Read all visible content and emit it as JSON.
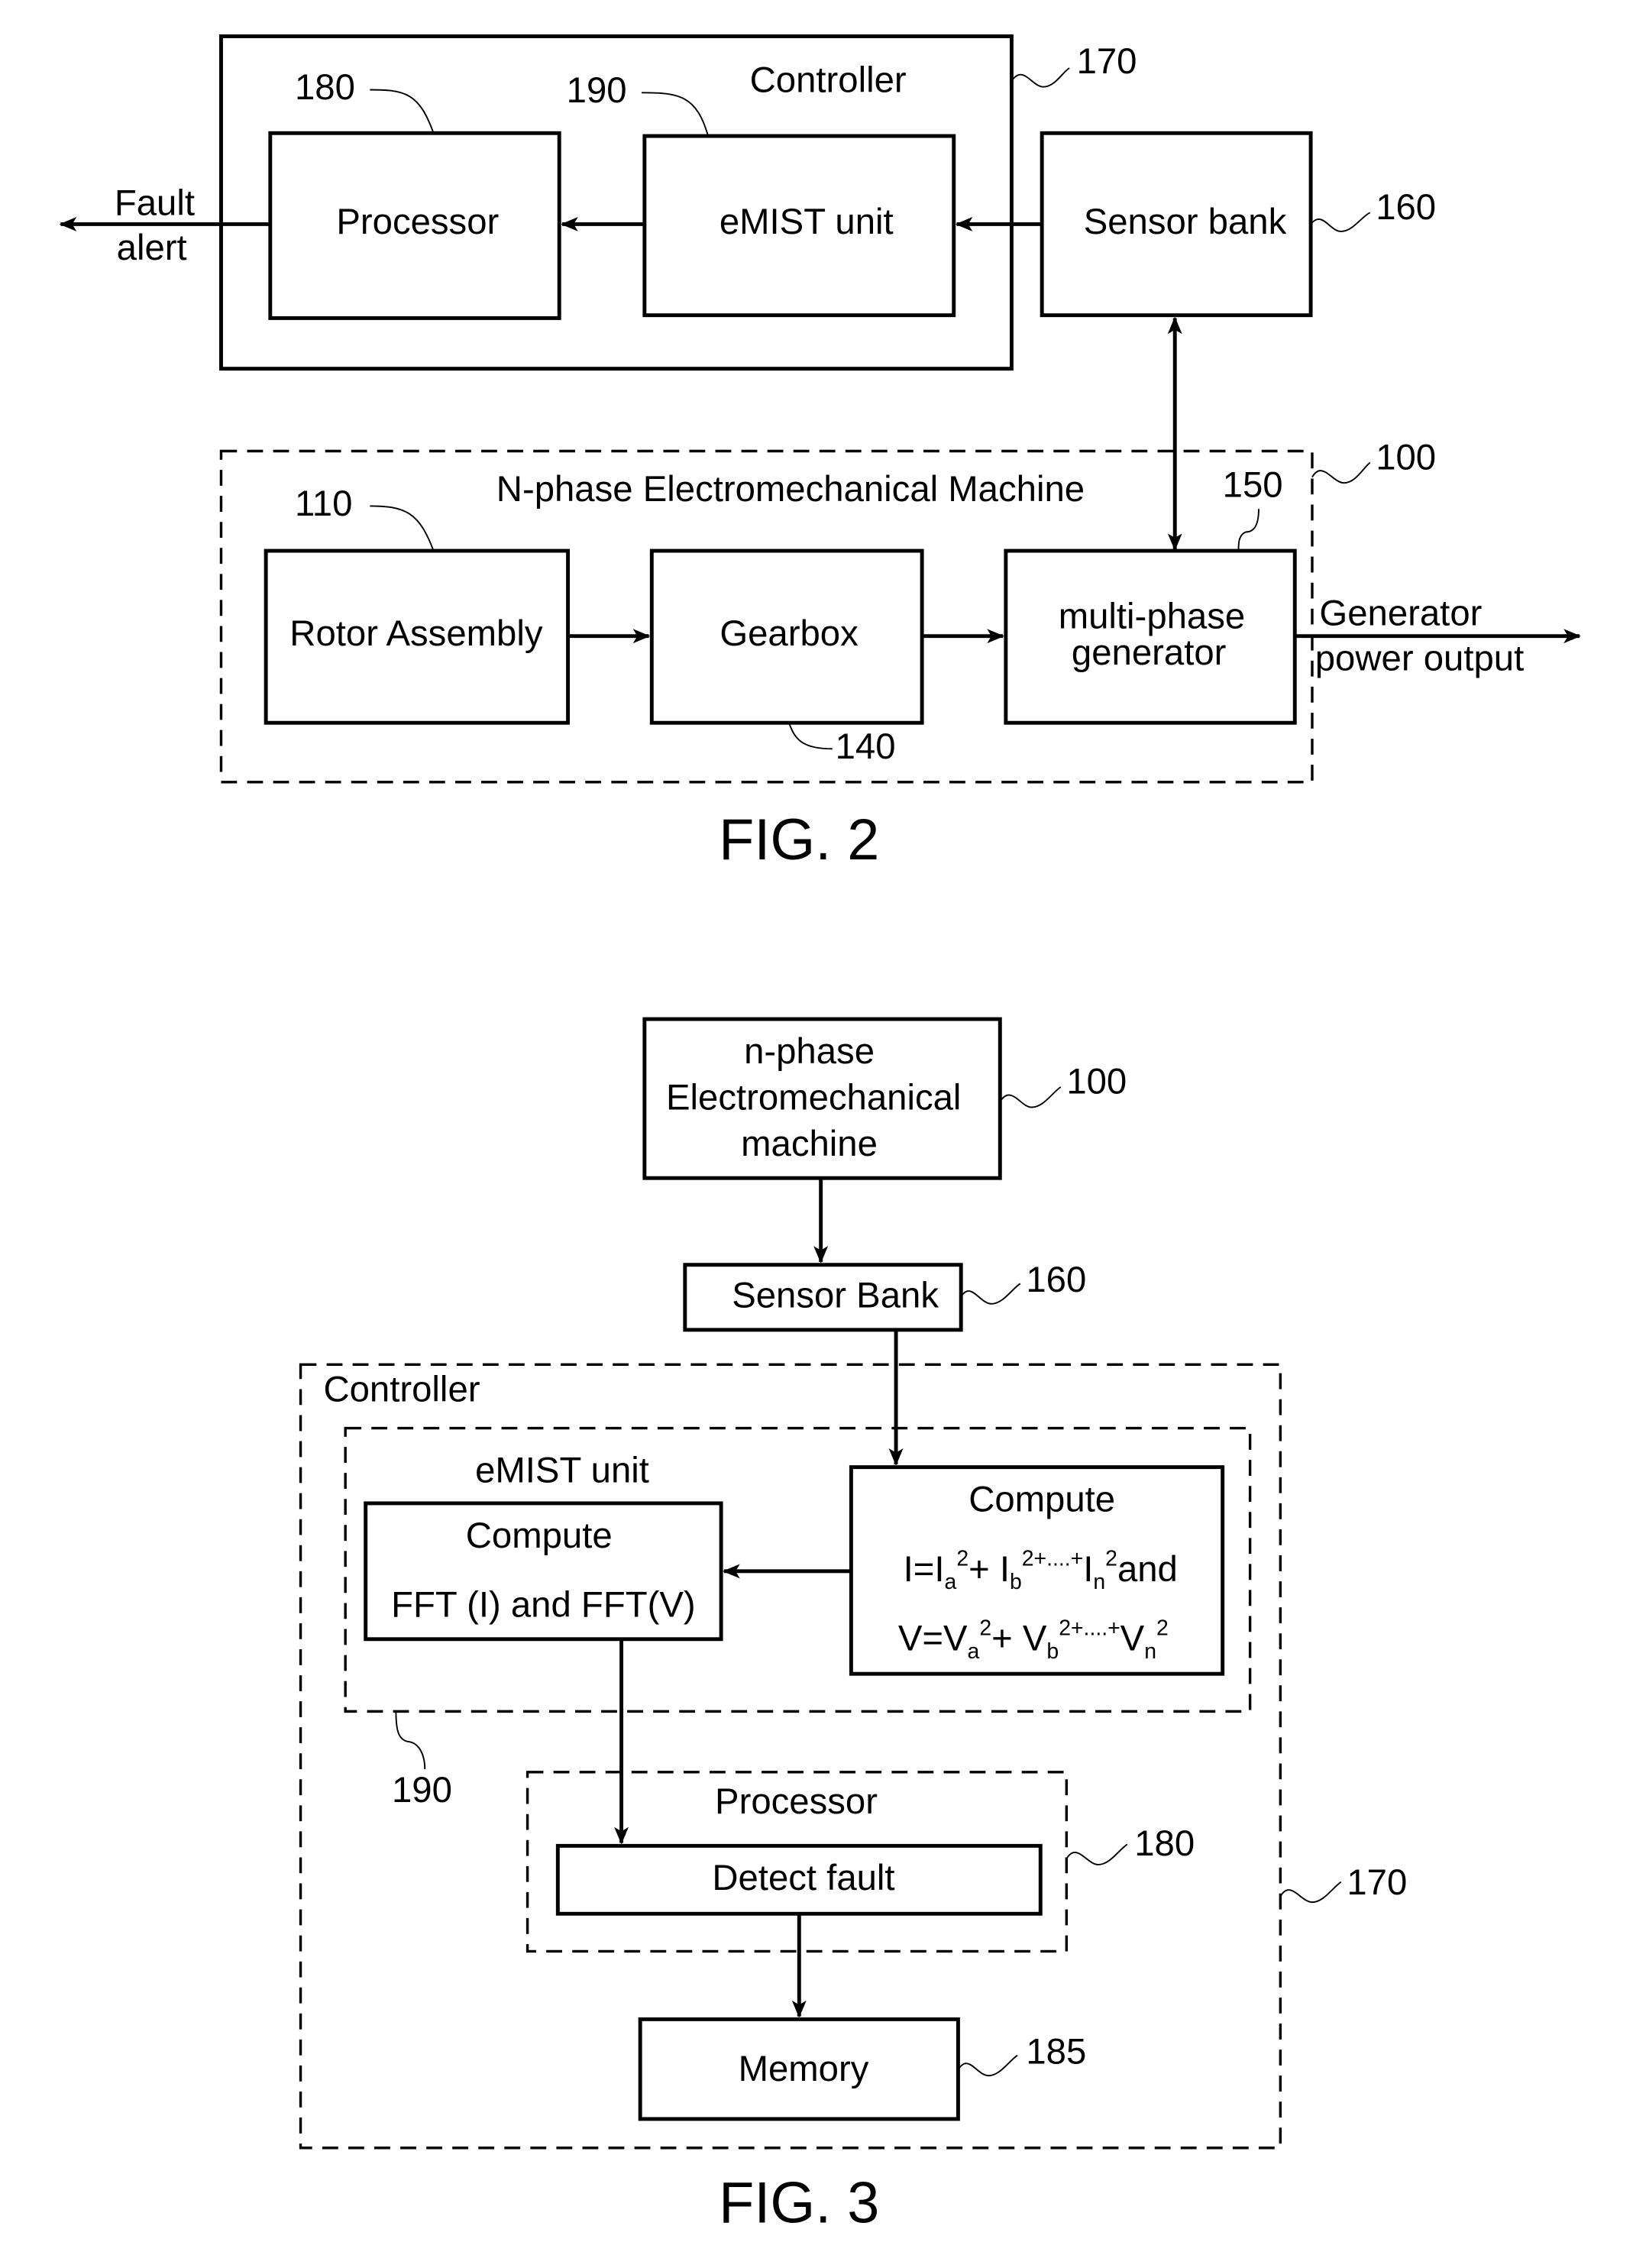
{
  "fig2": {
    "caption": "FIG. 2",
    "controller": {
      "label": "Controller",
      "ref": "170"
    },
    "processor": {
      "label": "Processor",
      "ref": "180"
    },
    "emist": {
      "label": "eMIST unit",
      "ref": "190"
    },
    "sensor_bank": {
      "label": "Sensor bank",
      "ref": "160"
    },
    "fault_alert": {
      "line1": "Fault",
      "line2": "alert"
    },
    "machine": {
      "label": "N-phase Electromechanical Machine",
      "ref": "100"
    },
    "rotor": {
      "label": "Rotor Assembly",
      "ref": "110"
    },
    "gearbox": {
      "label": "Gearbox",
      "ref": "140"
    },
    "generator": {
      "line1": "multi-phase",
      "line2": "generator",
      "ref": "150"
    },
    "output": {
      "line1": "Generator",
      "line2": "power output"
    }
  },
  "fig3": {
    "caption": "FIG. 3",
    "machine": {
      "line1": "n-phase",
      "line2": "Electromechanical",
      "line3": "machine",
      "ref": "100"
    },
    "sensor_bank": {
      "label": "Sensor Bank",
      "ref": "160"
    },
    "controller": {
      "label": "Controller",
      "ref": "170"
    },
    "emist": {
      "label": "eMIST unit",
      "ref": "190"
    },
    "fft": {
      "line1": "Compute",
      "line2": "FFT (I) and FFT(V)"
    },
    "compute": {
      "line1": "Compute",
      "eq_i": {
        "lhs": "I=I",
        "s1": "a",
        "p1": "2",
        "mid": "+ I",
        "s2": "b",
        "p2": "2+....+",
        "mid2": "I",
        "s3": "n",
        "p3": "2",
        "tail": "and"
      },
      "eq_v": {
        "lhs": "V=V",
        "s1": "a",
        "p1": "2",
        "mid": "+ V",
        "s2": "b",
        "p2": "2+....+",
        "mid2": "V",
        "s3": "n",
        "p3": "2"
      }
    },
    "processor": {
      "label": "Processor",
      "ref": "180"
    },
    "detect": {
      "label": "Detect fault"
    },
    "memory": {
      "label": "Memory",
      "ref": "185"
    }
  }
}
